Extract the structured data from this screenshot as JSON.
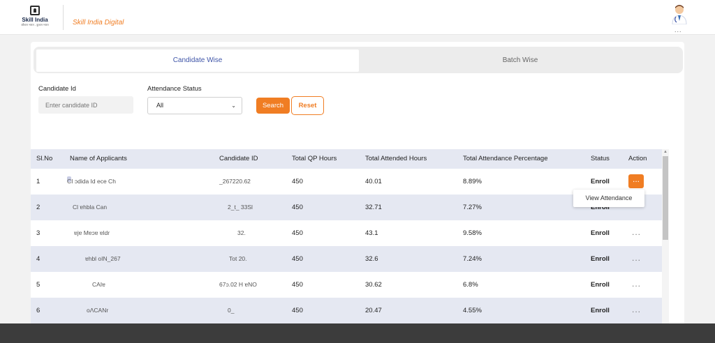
{
  "header": {
    "logo_text": "Skill India",
    "logo_subtext": "कौशल भारत - कुशल भारत",
    "brand": "Skill India Digital",
    "user_dots": "..."
  },
  "tabs": [
    {
      "label": "Candidate Wise",
      "active": true
    },
    {
      "label": "Batch Wise",
      "active": false
    }
  ],
  "filters": {
    "candidate_id_label": "Candidate Id",
    "candidate_id_placeholder": "Enter candidate ID",
    "attendance_status_label": "Attendance Status",
    "attendance_status_value": "All",
    "search_label": "Search",
    "reset_label": "Reset"
  },
  "table": {
    "headers": [
      "Sl.No",
      "Name of Applicants",
      "Candidate ID",
      "Total QP Hours",
      "Total Attended Hours",
      "Total Attendance Percentage",
      "Status",
      "Action"
    ],
    "rows": [
      {
        "sl": "1",
        "name": "CI ɔdida Id ece Ch",
        "cid": "_267220.62",
        "qp": "450",
        "attended": "40.01",
        "pct": "8.89%",
        "status": "Enroll"
      },
      {
        "sl": "2",
        "name": "Cl ɐhbla Can",
        "cid": "2_t_ 33Sl",
        "qp": "450",
        "attended": "32.71",
        "pct": "7.27%",
        "status": "Enroll"
      },
      {
        "sl": "3",
        "name": "ɐjɐ Mɐɔɐ ɐldr",
        "cid": "32.",
        "qp": "450",
        "attended": "43.1",
        "pct": "9.58%",
        "status": "Enroll"
      },
      {
        "sl": "4",
        "name": "ɐhbl oIN_267",
        "cid": "Tot 20.",
        "qp": "450",
        "attended": "32.6",
        "pct": "7.24%",
        "status": "Enroll"
      },
      {
        "sl": "5",
        "name": "CAIɐ",
        "cid": "67ɔ.02 H ɐNO",
        "qp": "450",
        "attended": "30.62",
        "pct": "6.8%",
        "status": "Enroll"
      },
      {
        "sl": "6",
        "name": "oɅCANr",
        "cid": "0_",
        "qp": "450",
        "attended": "20.47",
        "pct": "4.55%",
        "status": "Enroll"
      }
    ]
  },
  "action_menu": {
    "item": "View Attendance",
    "dots": "..."
  },
  "colors": {
    "accent": "#f07d23",
    "tab_active_text": "#3f55a8",
    "row_shade": "#e5e8f2"
  }
}
